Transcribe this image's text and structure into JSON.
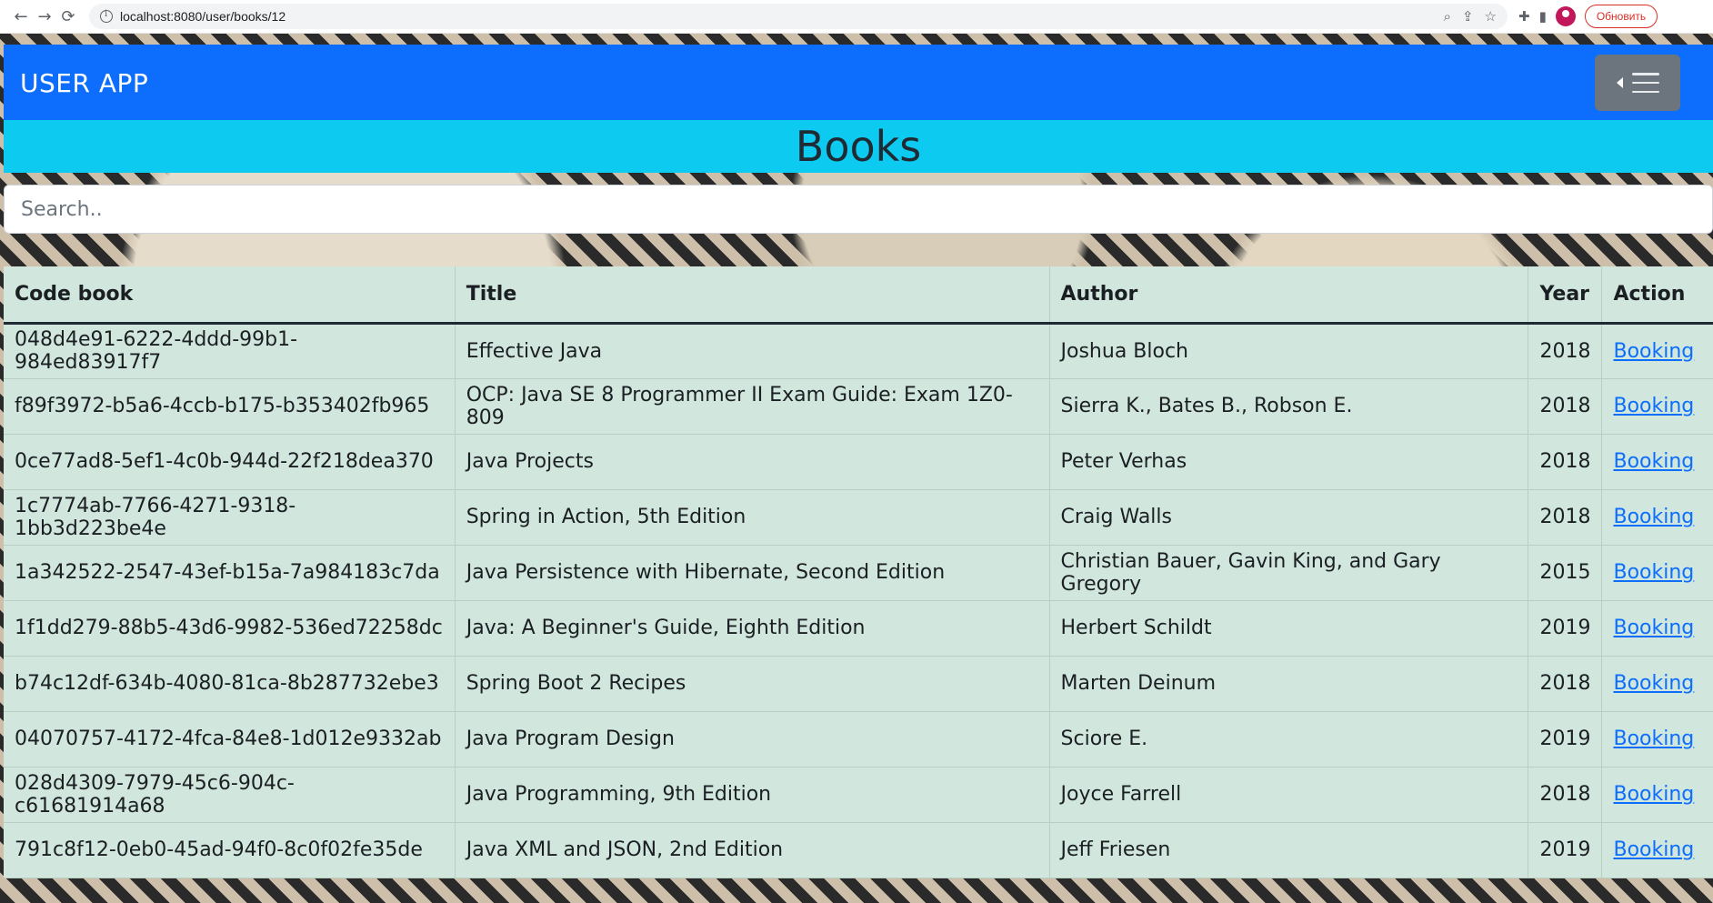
{
  "browser": {
    "url": "localhost:8080/user/books/12",
    "update_label": "Обновить"
  },
  "navbar": {
    "brand": "USER APP"
  },
  "page": {
    "title": "Books",
    "search_placeholder": "Search.."
  },
  "table": {
    "headers": [
      "Code book",
      "Title",
      "Author",
      "Year",
      "Action"
    ],
    "rows": [
      {
        "code": "048d4e91-6222-4ddd-99b1-984ed83917f7",
        "title": "Effective Java",
        "author": "Joshua Bloch",
        "year": "2018",
        "action": "Booking"
      },
      {
        "code": "f89f3972-b5a6-4ccb-b175-b353402fb965",
        "title": "OCP: Java SE 8 Programmer II Exam Guide: Exam 1Z0-809",
        "author": "Sierra K., Bates B., Robson E.",
        "year": "2018",
        "action": "Booking"
      },
      {
        "code": "0ce77ad8-5ef1-4c0b-944d-22f218dea370",
        "title": "Java Projects",
        "author": "Peter Verhas",
        "year": "2018",
        "action": "Booking"
      },
      {
        "code": "1c7774ab-7766-4271-9318-1bb3d223be4e",
        "title": "Spring in Action, 5th Edition",
        "author": "Craig Walls",
        "year": "2018",
        "action": "Booking"
      },
      {
        "code": "1a342522-2547-43ef-b15a-7a984183c7da",
        "title": "Java Persistence with Hibernate, Second Edition",
        "author": "Christian Bauer, Gavin King, and Gary Gregory",
        "year": "2015",
        "action": "Booking"
      },
      {
        "code": "1f1dd279-88b5-43d6-9982-536ed72258dc",
        "title": "Java: A Beginner's Guide, Eighth Edition",
        "author": "Herbert Schildt",
        "year": "2019",
        "action": "Booking"
      },
      {
        "code": "b74c12df-634b-4080-81ca-8b287732ebe3",
        "title": "Spring Boot 2 Recipes",
        "author": "Marten Deinum",
        "year": "2018",
        "action": "Booking"
      },
      {
        "code": "04070757-4172-4fca-84e8-1d012e9332ab",
        "title": "Java Program Design",
        "author": "Sciore E.",
        "year": "2019",
        "action": "Booking"
      },
      {
        "code": "028d4309-7979-45c6-904c-c61681914a68",
        "title": "Java Programming, 9th Edition",
        "author": "Joyce Farrell",
        "year": "2018",
        "action": "Booking"
      },
      {
        "code": "791c8f12-0eb0-45ad-94f0-8c0f02fe35de",
        "title": "Java XML and JSON, 2nd Edition",
        "author": "Jeff Friesen",
        "year": "2019",
        "action": "Booking"
      }
    ]
  }
}
